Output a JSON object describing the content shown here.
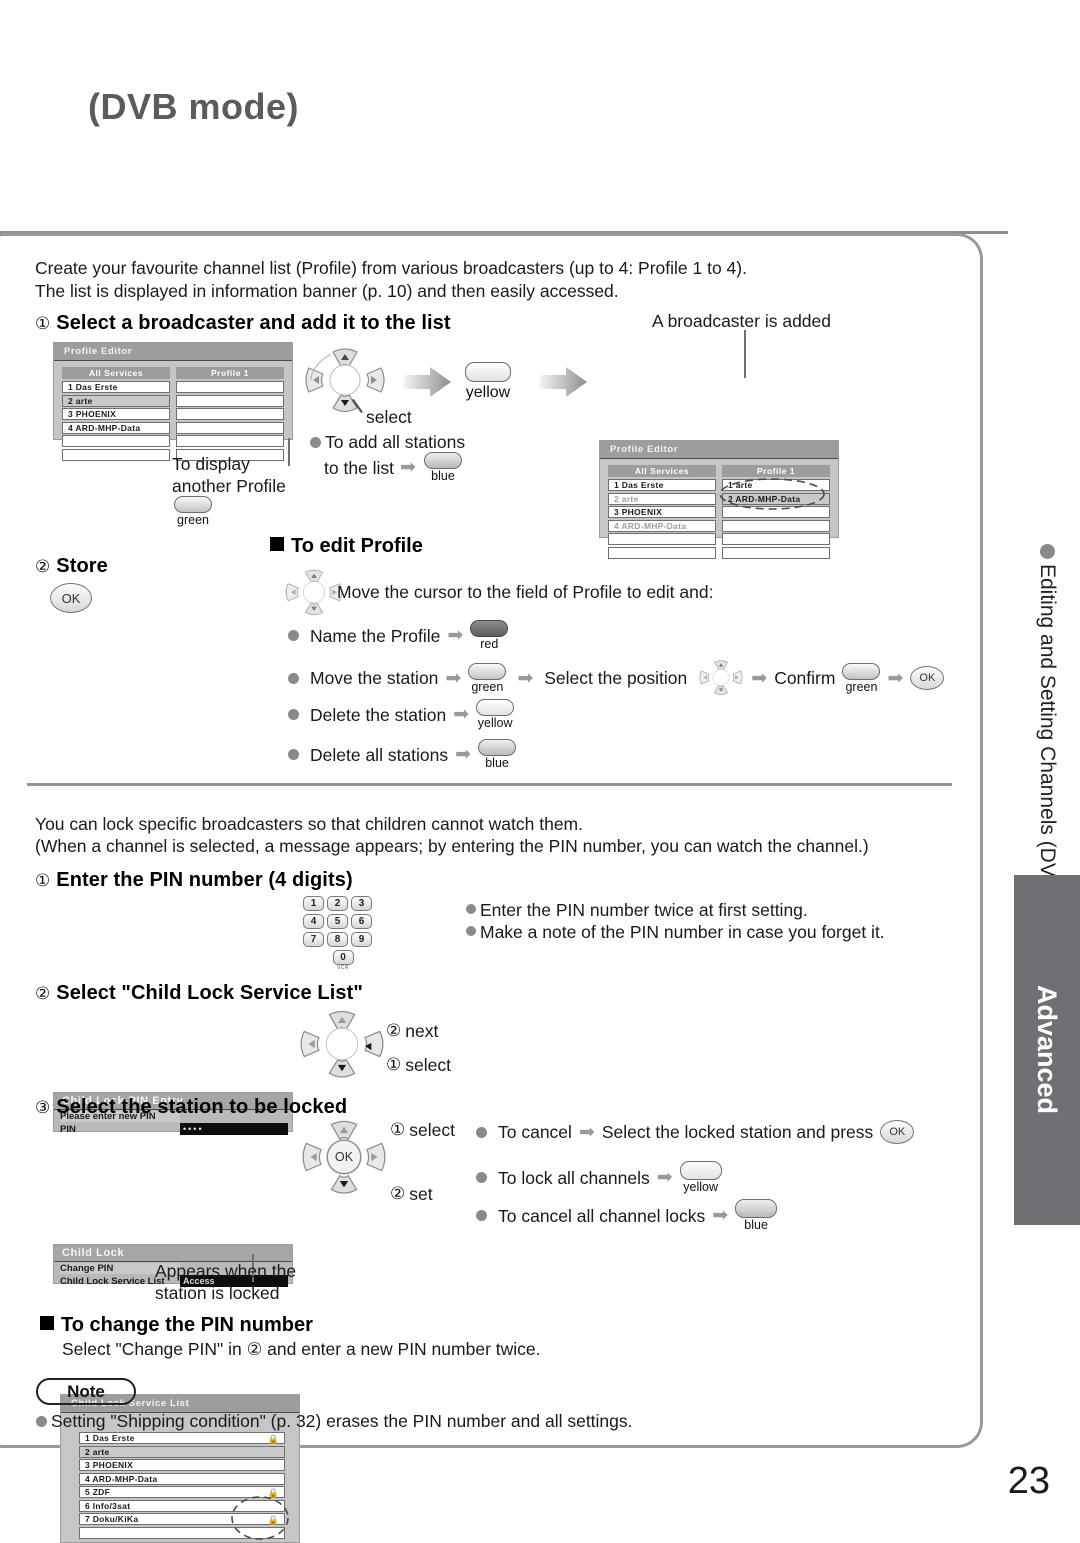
{
  "page": {
    "title": "(DVB mode)",
    "number": "23"
  },
  "sidebar": {
    "rail_label": "Editing and Setting Channels (DVB)",
    "tab_label": "Advanced"
  },
  "profile_section": {
    "intro_line1": "Create your favourite channel list (Profile) from various broadcasters (up to 4: Profile 1 to 4).",
    "intro_line2": "The list is displayed in information banner (p. 10) and then easily accessed.",
    "step1_num": "①",
    "step1_title": "Select a broadcaster and add it to the list",
    "added_caption": "A broadcaster is added",
    "select_label": "select",
    "yellow_label": "yellow",
    "add_all_line1": "To add all stations",
    "add_all_line2": "to the list",
    "blue_label": "blue",
    "display_other_line1": "To display",
    "display_other_line2": "another Profile",
    "green_label": "green",
    "step2_num": "②",
    "step2_title": "Store",
    "ok_label": "OK",
    "screen_left": {
      "title": "Profile Editor",
      "col1_head": "All Services",
      "col2_head": "Profile 1",
      "services": [
        "1  Das Erste",
        "2  arte",
        "3  PHOENIX",
        "4  ARD-MHP-Data",
        "",
        ""
      ],
      "selected_index": 1,
      "profile": [
        "",
        "",
        "",
        "",
        "",
        ""
      ]
    },
    "screen_right": {
      "title": "Profile Editor",
      "col1_head": "All Services",
      "col2_head": "Profile 1",
      "services": [
        "1  Das Erste",
        "2  arte",
        "3  PHOENIX",
        "4  ARD-MHP-Data",
        "",
        ""
      ],
      "dim_indices": [
        1,
        3
      ],
      "profile": [
        "1  arte",
        "2  ARD-MHP-Data",
        "",
        "",
        "",
        ""
      ],
      "profile_selected_index": 1
    }
  },
  "edit_profile": {
    "heading": "To edit Profile",
    "intro": "Move the cursor to the field of Profile to edit and:",
    "items": [
      {
        "label": "Name the Profile",
        "button": "red"
      },
      {
        "label": "Move the station",
        "button": "green"
      },
      {
        "label": "Delete the station",
        "button": "yellow"
      },
      {
        "label": "Delete all stations",
        "button": "blue"
      }
    ],
    "move_extra": {
      "select_position": "Select the position",
      "confirm": "Confirm",
      "confirm_button": "green",
      "ok_label": "OK"
    }
  },
  "childlock_section": {
    "intro_line1": "You can lock specific broadcasters so that children cannot watch them.",
    "intro_line2": "(When a channel is selected, a message appears; by entering the PIN number, you can watch the channel.)",
    "step1_num": "①",
    "step1_title": "Enter the PIN number (4 digits)",
    "pin_screen": {
      "title": "Child Lock-PIN Entry",
      "prompt": "Please enter new PIN",
      "field_label": "PIN",
      "field_value": "••••"
    },
    "keypad": [
      "1",
      "2",
      "3",
      "4",
      "5",
      "6",
      "7",
      "8",
      "9",
      "0"
    ],
    "keypad_sub": "VCR",
    "notes": [
      "Enter the PIN number twice at first setting.",
      "Make a note of the PIN number in case you forget it."
    ],
    "step2_num": "②",
    "step2_title": "Select \"Child Lock Service List\"",
    "childlock_screen": {
      "title": "Child Lock",
      "rows": [
        {
          "label": "Change PIN",
          "value": ""
        },
        {
          "label": "Child Lock Service List",
          "value": "Access"
        }
      ]
    },
    "dpad2_next_num": "②",
    "dpad2_next": "next",
    "dpad2_select_num": "①",
    "dpad2_select": "select",
    "step3_num": "③",
    "step3_title": "Select the station to be locked",
    "service_list": {
      "title": "Child Lock Service List",
      "rows": [
        {
          "label": "1   Das Erste",
          "locked": true,
          "selected": false
        },
        {
          "label": "2   arte",
          "locked": false,
          "selected": true
        },
        {
          "label": "3   PHOENIX",
          "locked": false,
          "selected": false
        },
        {
          "label": "4   ARD-MHP-Data",
          "locked": false,
          "selected": false
        },
        {
          "label": "5   ZDF",
          "locked": true,
          "selected": false
        },
        {
          "label": "6   Info/3sat",
          "locked": false,
          "selected": false
        },
        {
          "label": "7   Doku/KiKa",
          "locked": true,
          "selected": false
        },
        {
          "label": "",
          "locked": false,
          "selected": false
        }
      ]
    },
    "dpad3_select_num": "①",
    "dpad3_select": "select",
    "dpad3_set_num": "②",
    "dpad3_set": "set",
    "ok_label": "OK",
    "bullets": [
      {
        "prefix": "To cancel",
        "text": "Select the locked station and press",
        "trailing": "ok"
      },
      {
        "prefix": "To lock all channels",
        "text": "",
        "trailing": "yellow"
      },
      {
        "prefix": "To cancel all channel locks",
        "text": "",
        "trailing": "blue"
      }
    ],
    "locked_caption_line1": "Appears when the",
    "locked_caption_line2": "station is locked",
    "change_pin_heading": "To change the PIN number",
    "change_pin_body": "Select \"Change PIN\" in ② and enter a new PIN number twice.",
    "note_label": "Note",
    "note_text": "Setting \"Shipping condition\" (p. 32) erases the PIN number and all settings."
  }
}
